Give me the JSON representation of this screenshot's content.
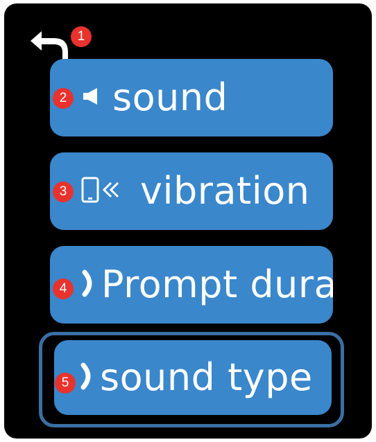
{
  "annotations": [
    "1",
    "2",
    "3",
    "4",
    "5"
  ],
  "back": {
    "icon": "back-arrow-icon"
  },
  "menu": {
    "items": [
      {
        "label": "sound",
        "icon": "speaker-icon"
      },
      {
        "label": "vibration",
        "icon": "phone-vibration-icon"
      },
      {
        "label": "Prompt duration",
        "icon": "half-circle-icon"
      },
      {
        "label": "sound type",
        "icon": "half-circle-icon"
      }
    ],
    "focused_index": 3
  },
  "colors": {
    "background": "#000000",
    "button": "#3a87cb",
    "focus_ring": "#3a6fa3",
    "badge": "#e8322d",
    "text": "#ffffff"
  }
}
